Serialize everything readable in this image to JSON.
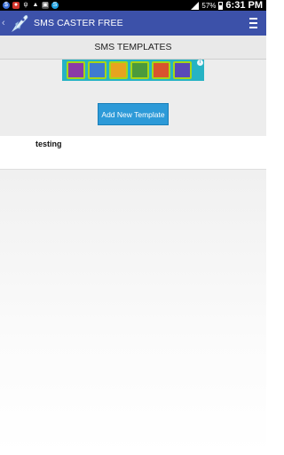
{
  "status_bar": {
    "battery_percent": "57%",
    "time": "6:31 PM",
    "notification_icons": [
      "dollar-app-icon",
      "red-app-icon",
      "usb-icon",
      "android-icon",
      "bag-icon",
      "skype-icon"
    ]
  },
  "app_bar": {
    "title": "SMS CASTER FREE",
    "color": "#3c51a9"
  },
  "header": {
    "title": "SMS TEMPLATES"
  },
  "ad": {
    "tiles": [
      "#8b3aa7",
      "#3f7ad0",
      "#e7a31f",
      "#4b9a3c",
      "#d9532e",
      "#5a48b8"
    ]
  },
  "actions": {
    "add_label": "Add New Template",
    "add_color": "#2d9ad8"
  },
  "templates": [
    {
      "name": "testing"
    }
  ]
}
